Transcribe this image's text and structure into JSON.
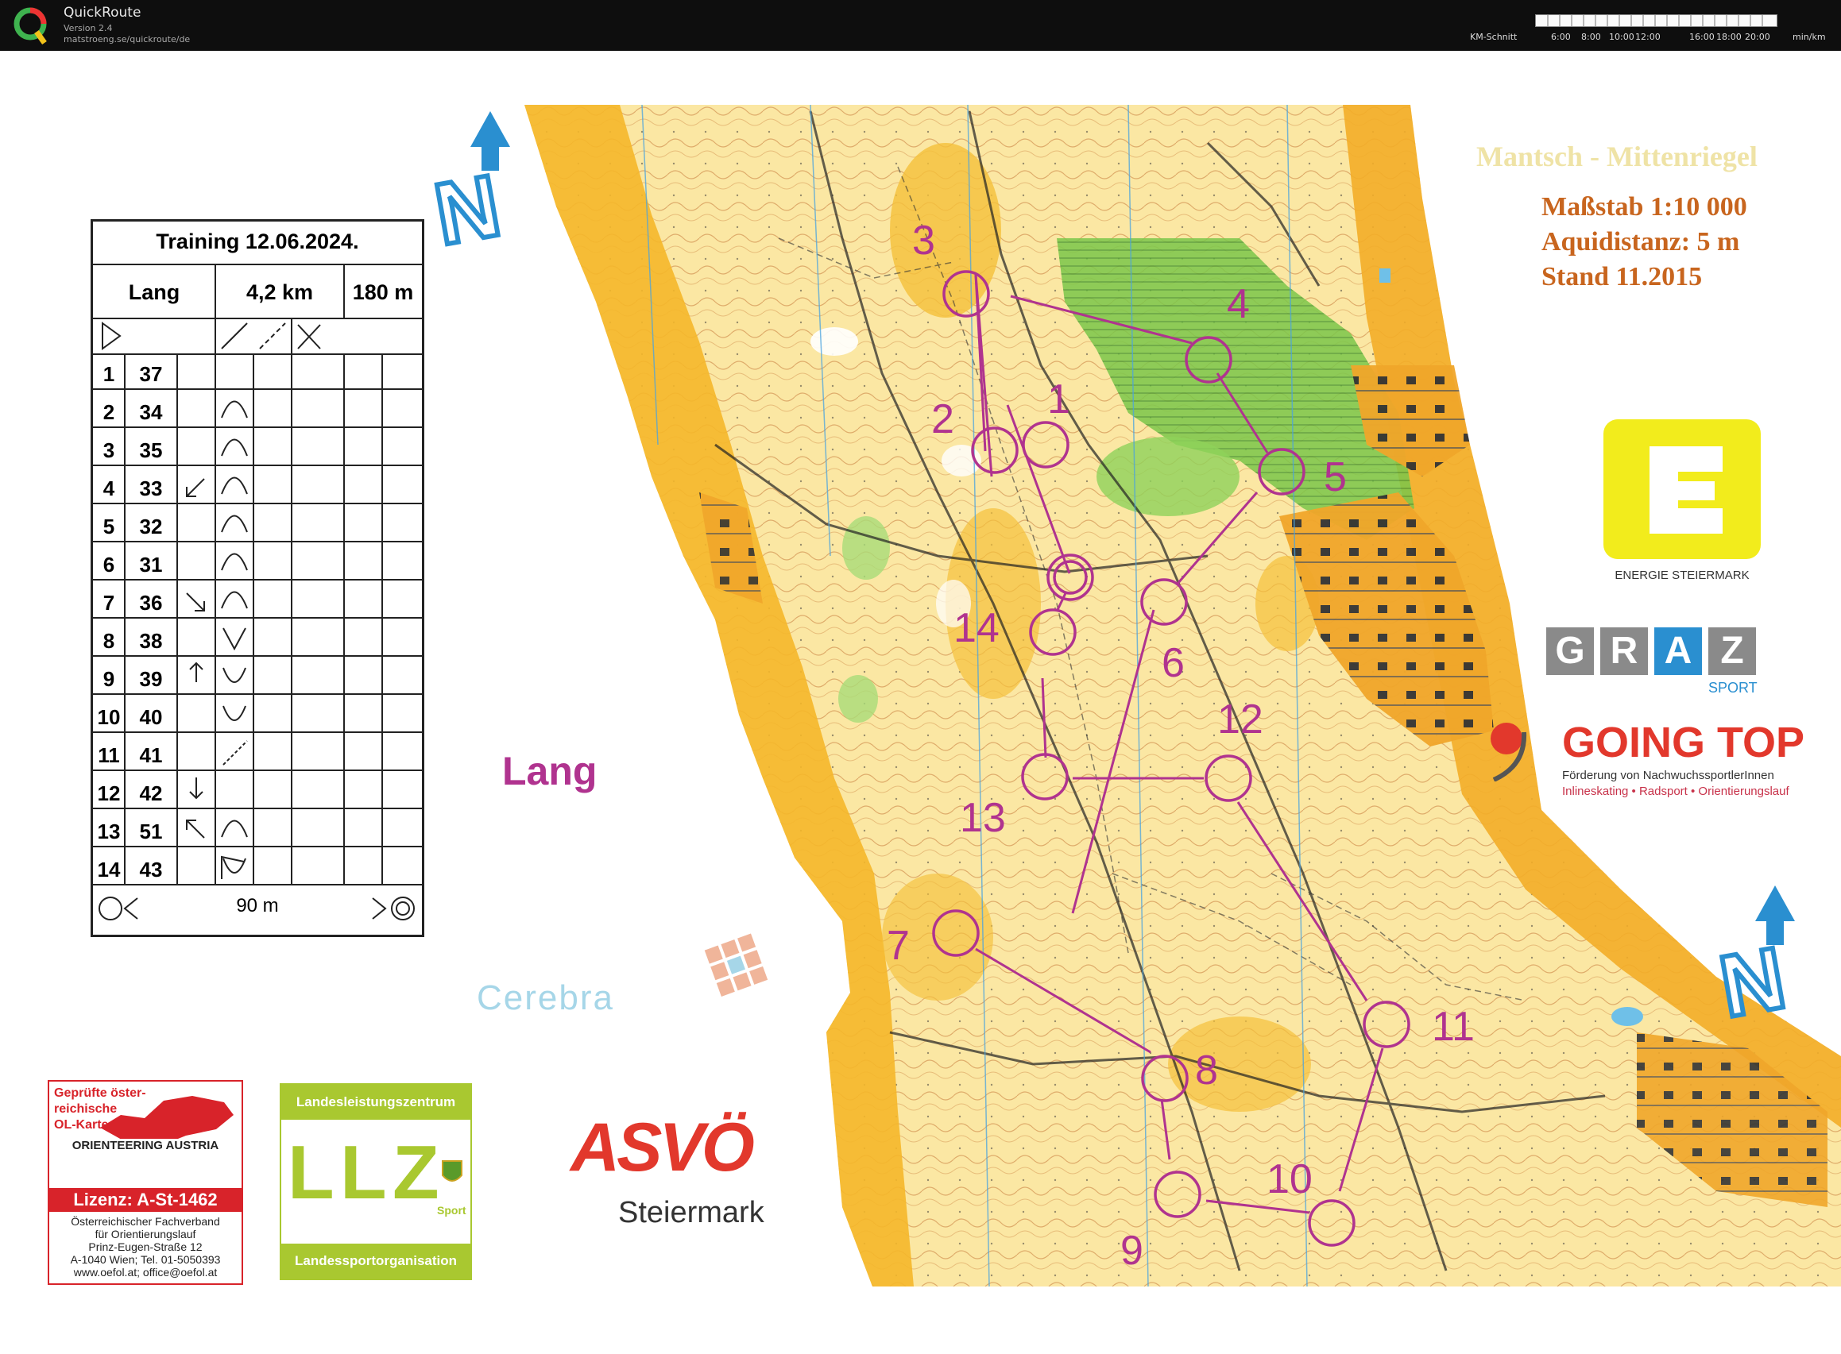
{
  "app": {
    "name": "QuickRoute",
    "version": "Version 2.4",
    "url": "matstroeng.se/quickroute/de",
    "scale_label_left": "KM-Schnitt",
    "scale_ticks": [
      "6:00",
      "8:00",
      "10:00",
      "12:00",
      "16:00",
      "18:00",
      "20:00"
    ],
    "scale_unit": "min/km"
  },
  "map": {
    "title_faded": "Mantsch - Mittenriegel",
    "scale": "Maßstab 1:10 000",
    "equidistance": "Aquidistanz: 5 m",
    "stand": "Stand 11.2015",
    "course_label": "Lang",
    "north_letter": "N",
    "control_numbers": [
      "1",
      "2",
      "3",
      "4",
      "5",
      "6",
      "7",
      "8",
      "9",
      "10",
      "11",
      "12",
      "13",
      "14"
    ]
  },
  "description_sheet": {
    "title": "Training 12.06.2024.",
    "course": "Lang",
    "length": "4,2 km",
    "climb": "180 m",
    "rows": [
      {
        "n": "1",
        "code": "37"
      },
      {
        "n": "2",
        "code": "34"
      },
      {
        "n": "3",
        "code": "35"
      },
      {
        "n": "4",
        "code": "33"
      },
      {
        "n": "5",
        "code": "32"
      },
      {
        "n": "6",
        "code": "31"
      },
      {
        "n": "7",
        "code": "36"
      },
      {
        "n": "8",
        "code": "38"
      },
      {
        "n": "9",
        "code": "39"
      },
      {
        "n": "10",
        "code": "40"
      },
      {
        "n": "11",
        "code": "41"
      },
      {
        "n": "12",
        "code": "42"
      },
      {
        "n": "13",
        "code": "51"
      },
      {
        "n": "14",
        "code": "43"
      }
    ],
    "finish_distance": "90 m"
  },
  "sponsors": {
    "energie": "ENERGIE STEIERMARK",
    "graz_letters": [
      "G",
      "R",
      "A",
      "Z"
    ],
    "graz_sub": "SPORT",
    "going_top": "GOING TOP",
    "going_top_sub1": "Förderung von NachwuchssportlerInnen",
    "going_top_sub2": "Inlineskating • Radsport • Orientierungslauf",
    "cerebra": "Cerebra",
    "asvo": "ASVÖ",
    "asvo_sub": "Steiermark",
    "llz_top": "Landesleistungszentrum",
    "llz_letters": [
      "L",
      "L",
      "Z"
    ],
    "llz_sport": "Sport",
    "llz_bottom": "Landessportorganisation",
    "oefol_1": "Geprüfte öster-",
    "oefol_2": "reichische",
    "oefol_3": "OL-Karte",
    "oefol_4": "ORIENTEERING AUSTRIA",
    "oefol_license": "Lizenz: A-St-1462",
    "oefol_5": "Österreichischer Fachverband",
    "oefol_6": "für Orientierungslauf",
    "oefol_7": "Prinz-Eugen-Straße 12",
    "oefol_8": "A-1040 Wien; Tel. 01-5050393",
    "oefol_9": "www.oefol.at; office@oefol.at"
  },
  "colors": {
    "course": "#b0338f",
    "orange_text": "#c8651e",
    "energie_yellow": "#f2ec1c",
    "going_red": "#e2382c",
    "map_yellow": "#f7c432",
    "map_green": "#8fd25a",
    "north_blue": "#2a8fd0"
  }
}
